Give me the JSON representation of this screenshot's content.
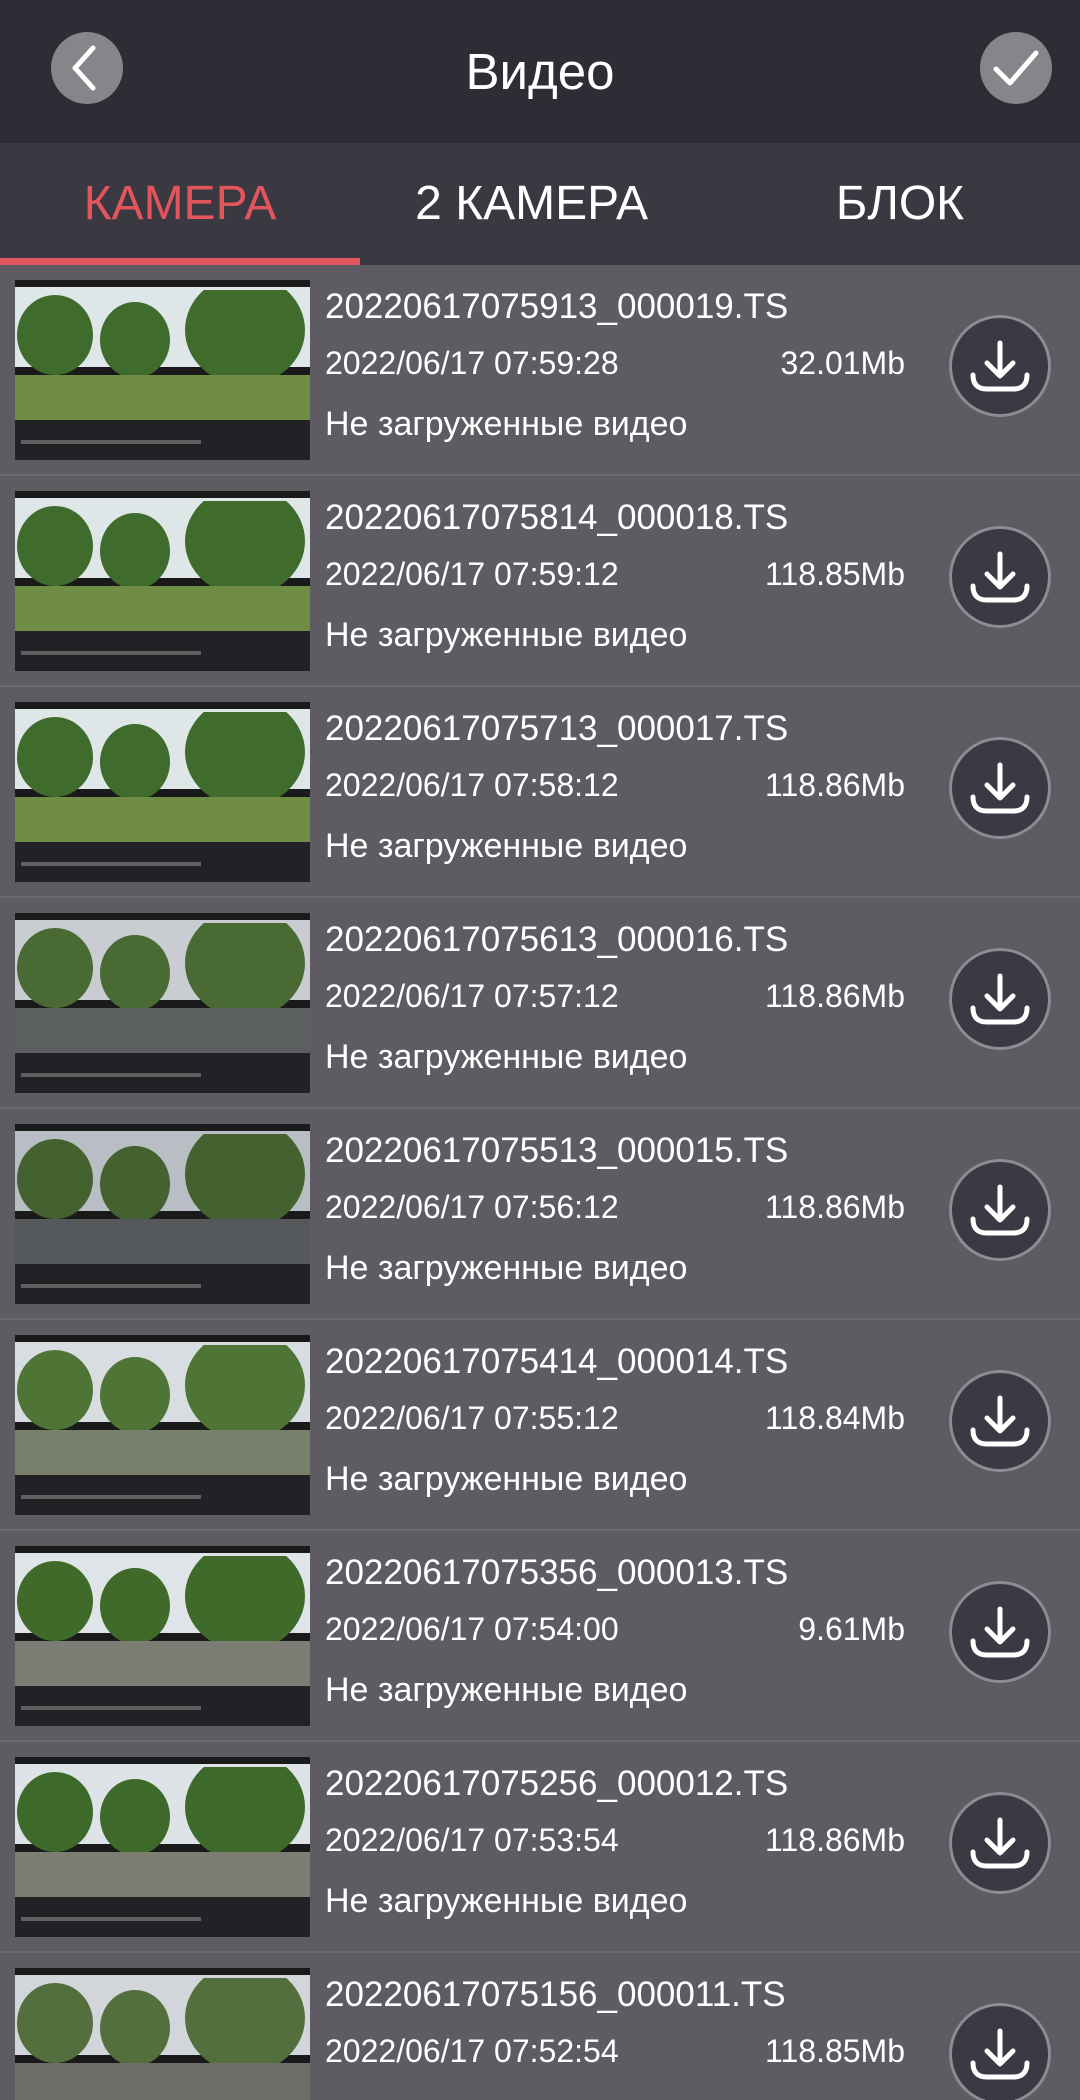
{
  "header": {
    "title": "Видео",
    "back_icon": "chevron-left-icon",
    "confirm_icon": "checkmark-icon"
  },
  "tabs": [
    {
      "label": "КАМЕРА",
      "active": true
    },
    {
      "label": "2 КАМЕРА",
      "active": false
    },
    {
      "label": "БЛОК",
      "active": false
    }
  ],
  "colors": {
    "accent": "#e3555c",
    "header_bg": "#2e2c35",
    "tabs_bg": "#3a3841",
    "list_bg": "#5f5b63"
  },
  "videos": [
    {
      "filename": "20220617075913_000019.TS",
      "datetime": "2022/06/17 07:59:28",
      "size": "32.01Mb",
      "status": "Не загруженные видео"
    },
    {
      "filename": "20220617075814_000018.TS",
      "datetime": "2022/06/17 07:59:12",
      "size": "118.85Mb",
      "status": "Не загруженные видео"
    },
    {
      "filename": "20220617075713_000017.TS",
      "datetime": "2022/06/17 07:58:12",
      "size": "118.86Mb",
      "status": "Не загруженные видео"
    },
    {
      "filename": "20220617075613_000016.TS",
      "datetime": "2022/06/17 07:57:12",
      "size": "118.86Mb",
      "status": "Не загруженные видео"
    },
    {
      "filename": "20220617075513_000015.TS",
      "datetime": "2022/06/17 07:56:12",
      "size": "118.86Mb",
      "status": "Не загруженные видео"
    },
    {
      "filename": "20220617075414_000014.TS",
      "datetime": "2022/06/17 07:55:12",
      "size": "118.84Mb",
      "status": "Не загруженные видео"
    },
    {
      "filename": "20220617075356_000013.TS",
      "datetime": "2022/06/17 07:54:00",
      "size": "9.61Mb",
      "status": "Не загруженные видео"
    },
    {
      "filename": "20220617075256_000012.TS",
      "datetime": "2022/06/17 07:53:54",
      "size": "118.86Mb",
      "status": "Не загруженные видео"
    },
    {
      "filename": "20220617075156_000011.TS",
      "datetime": "2022/06/17 07:52:54",
      "size": "118.85Mb",
      "status": ""
    }
  ],
  "download_icon": "download-icon"
}
